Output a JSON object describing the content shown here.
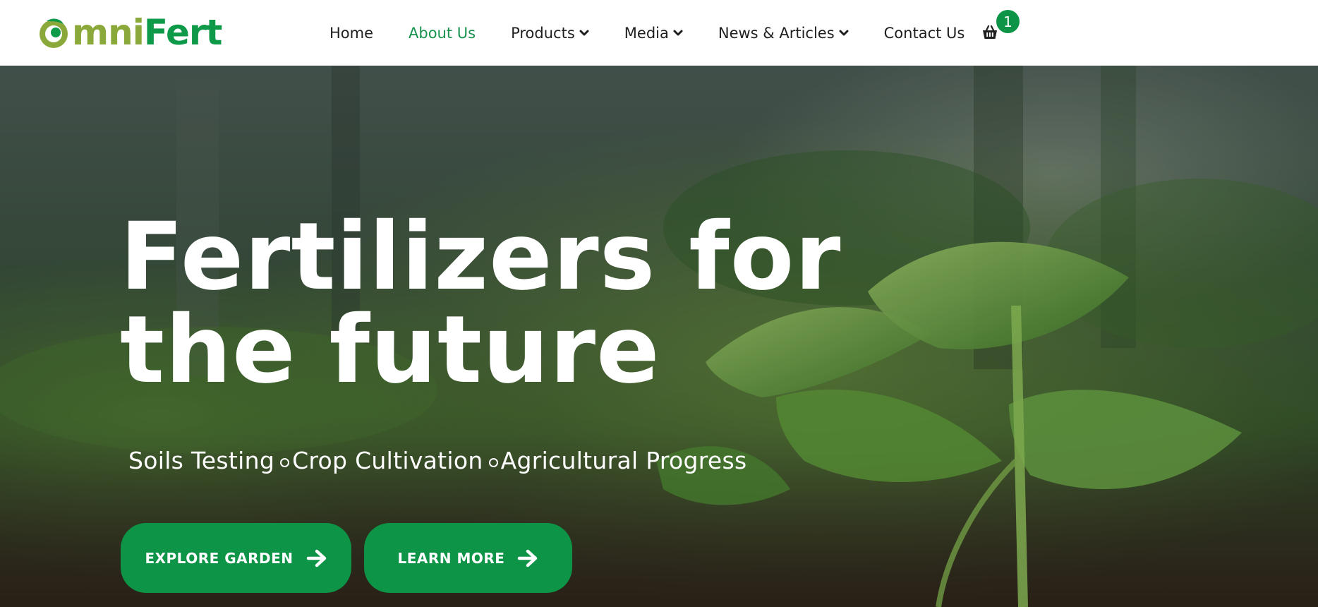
{
  "brand": {
    "logo_omni": "mni",
    "logo_fert": "Fert",
    "colors": {
      "primary": "#0d9447",
      "logo_light": "#8ba83a",
      "nav_text": "#1f1f1f",
      "active_nav": "#17924d"
    }
  },
  "nav": {
    "items": [
      {
        "label": "Home",
        "active": false,
        "dropdown": false
      },
      {
        "label": "About Us",
        "active": true,
        "dropdown": false
      },
      {
        "label": "Products",
        "active": false,
        "dropdown": true
      },
      {
        "label": "Media",
        "active": false,
        "dropdown": true
      },
      {
        "label": "News & Articles",
        "active": false,
        "dropdown": true
      },
      {
        "label": "Contact Us",
        "active": false,
        "dropdown": false
      }
    ],
    "cart_icon": "basket-icon",
    "cart_count": "1"
  },
  "hero": {
    "title_line1": "Fertilizers for",
    "title_line2": "the future",
    "tagline": [
      "Soils Testing",
      "Crop Cultivation",
      "Agricultural Progress"
    ],
    "buttons": {
      "explore_label": "EXPLORE GARDEN",
      "learn_label": "LEARN MORE",
      "icon": "arrow-right-icon"
    }
  }
}
